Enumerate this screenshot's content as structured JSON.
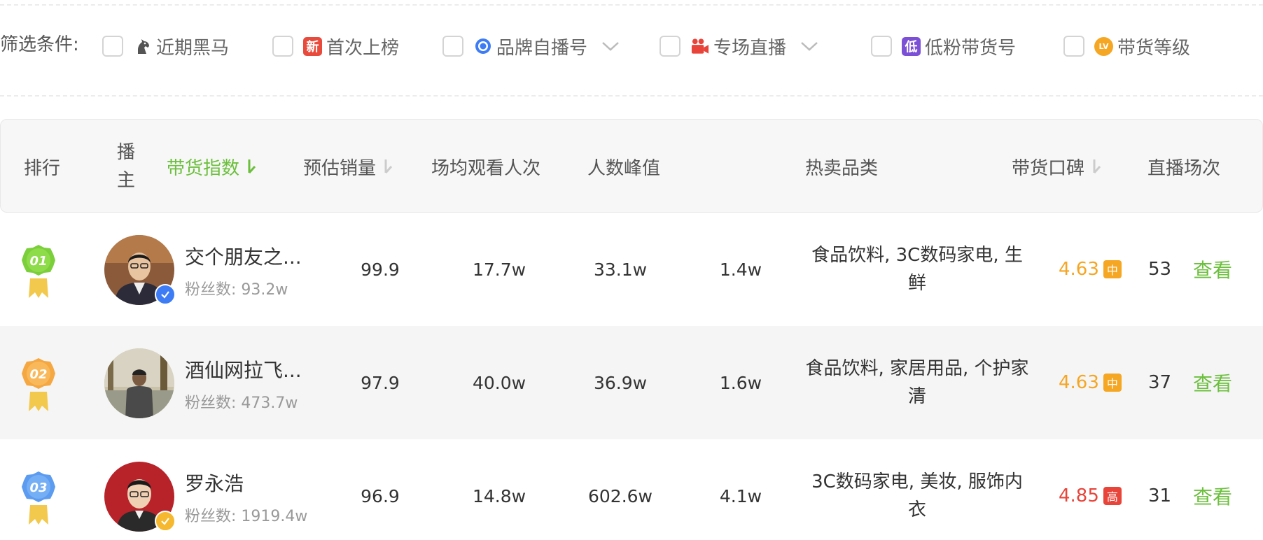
{
  "filters": {
    "label": "筛选条件:",
    "items": [
      {
        "label": "近期黑马",
        "icon": "horse-icon"
      },
      {
        "label": "首次上榜",
        "icon": "new-badge-icon",
        "badge": "新",
        "color": "#e84a3c"
      },
      {
        "label": "品牌自播号",
        "icon": "brand-medal-icon",
        "dropdown": true
      },
      {
        "label": "专场直播",
        "icon": "camera-icon",
        "dropdown": true
      },
      {
        "label": "低粉带货号",
        "icon": "low-badge-icon",
        "badge": "低",
        "color": "#7b4fd6"
      },
      {
        "label": "带货等级",
        "icon": "level-badge-icon",
        "badge": "LV",
        "color": "#f5a623"
      }
    ]
  },
  "table": {
    "headers": {
      "rank": "排行",
      "host_line1": "播",
      "host_line2": "主",
      "sales_index": "带货指数",
      "est_sales": "预估销量",
      "avg_views": "场均观看人次",
      "peak": "人数峰值",
      "hot_categories": "热卖品类",
      "reputation": "带货口碑",
      "sessions": "直播场次"
    },
    "rows": [
      {
        "rank": "01",
        "name": "交个朋友之...",
        "fans": "粉丝数: 93.2w",
        "sales_index": "99.9",
        "est_sales": "17.7w",
        "avg_views": "33.1w",
        "peak": "1.4w",
        "categories": "食品饮料, 3C数码家电, 生鲜",
        "rating": "4.63",
        "rating_badge": "中",
        "sessions": "53",
        "action": "查看"
      },
      {
        "rank": "02",
        "name": "酒仙网拉飞...",
        "fans": "粉丝数: 473.7w",
        "sales_index": "97.9",
        "est_sales": "40.0w",
        "avg_views": "36.9w",
        "peak": "1.6w",
        "categories": "食品饮料, 家居用品, 个护家清",
        "rating": "4.63",
        "rating_badge": "中",
        "sessions": "37",
        "action": "查看"
      },
      {
        "rank": "03",
        "name": "罗永浩",
        "fans": "粉丝数: 1919.4w",
        "sales_index": "96.9",
        "est_sales": "14.8w",
        "avg_views": "602.6w",
        "peak": "4.1w",
        "categories": "3C数码家电, 美妆, 服饰内衣",
        "rating": "4.85",
        "rating_badge": "高",
        "sessions": "31",
        "action": "查看"
      }
    ]
  },
  "colors": {
    "accent_green": "#6cbf3d",
    "rating_mid": "#f5a623",
    "rating_high": "#e8443a",
    "verify_blue": "#3d7cf5",
    "verify_gold": "#f5b82e"
  }
}
